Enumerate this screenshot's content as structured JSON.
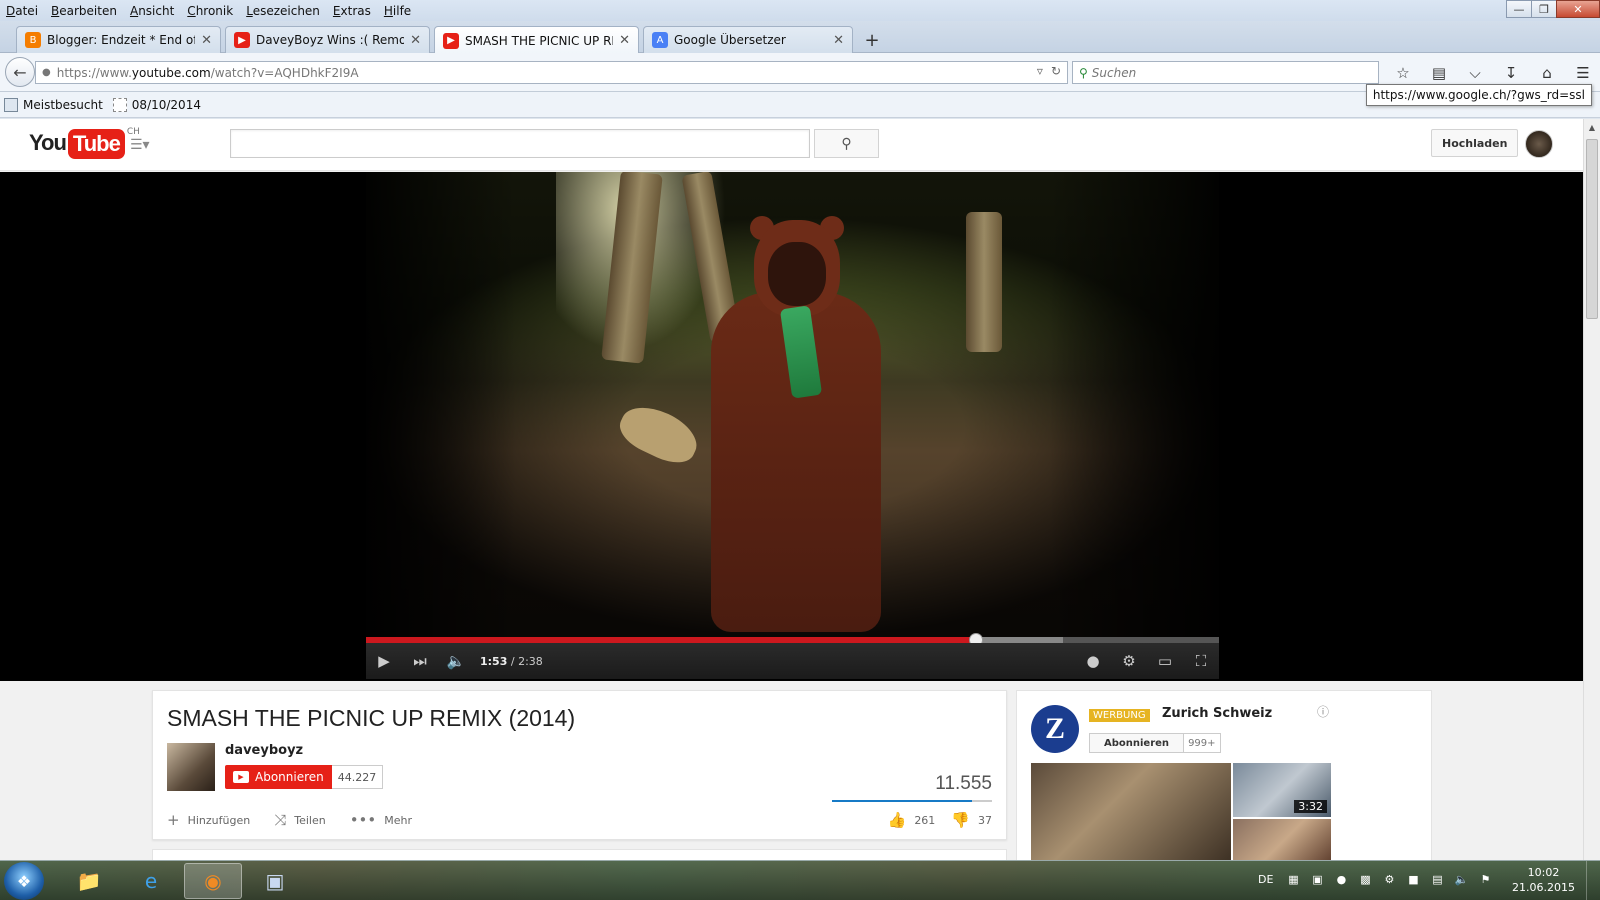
{
  "menubar": {
    "items": [
      "Datei",
      "Bearbeiten",
      "Ansicht",
      "Chronik",
      "Lesezeichen",
      "Extras",
      "Hilfe"
    ]
  },
  "tabs": [
    {
      "label": "Blogger: Endzeit * End of Ti...",
      "icon": "blogger-icon",
      "color": "#f57d00"
    },
    {
      "label": "DaveyBoyz Wins :( Removi...",
      "icon": "youtube-icon",
      "color": "#e62117"
    },
    {
      "label": "SMASH THE PICNIC UP RE...",
      "icon": "youtube-icon",
      "color": "#e62117",
      "active": true
    },
    {
      "label": "Google Übersetzer",
      "icon": "google-translate-icon",
      "color": "#4a80f5"
    }
  ],
  "nav": {
    "url_prefix": "https://www.",
    "url_host": "youtube.com",
    "url_rest": "/watch?v=AQHDhkF2I9A",
    "search_placeholder": "Suchen"
  },
  "bookmarks": [
    {
      "label": "Meistbesucht"
    },
    {
      "label": "08/10/2014"
    }
  ],
  "tooltip": "https://www.google.ch/?gws_rd=ssl",
  "youtube": {
    "logo_you": "You",
    "logo_tube": "Tube",
    "logo_region": "CH",
    "upload_label": "Hochladen",
    "search_value": ""
  },
  "player": {
    "current_time": "1:53",
    "duration": "/ 2:38",
    "played_fraction": 0.715,
    "buffered_fraction": 0.817
  },
  "video": {
    "title": "SMASH THE PICNIC UP REMIX (2014)",
    "channel": "daveyboyz",
    "subscribe_label": "Abonnieren",
    "subscriber_count": "44.227",
    "view_count": "11.555",
    "like_ratio": 0.876,
    "actions": {
      "add": "Hinzufügen",
      "share": "Teilen",
      "more": "Mehr"
    },
    "likes": "261",
    "dislikes": "37"
  },
  "ad": {
    "logo_letter": "Z",
    "badge": "WERBUNG",
    "name": "Zurich Schweiz",
    "subscribe_label": "Abonnieren",
    "subscriber_count": "999+",
    "duration": "3:32"
  },
  "taskbar": {
    "language": "DE",
    "time": "10:02",
    "date": "21.06.2015"
  },
  "colors": {
    "youtube_red": "#e62117",
    "progress_red": "#cc181e",
    "like_blue": "#167ac6",
    "ad_badge": "#e6b422",
    "zurich_blue": "#1b3d8f"
  }
}
